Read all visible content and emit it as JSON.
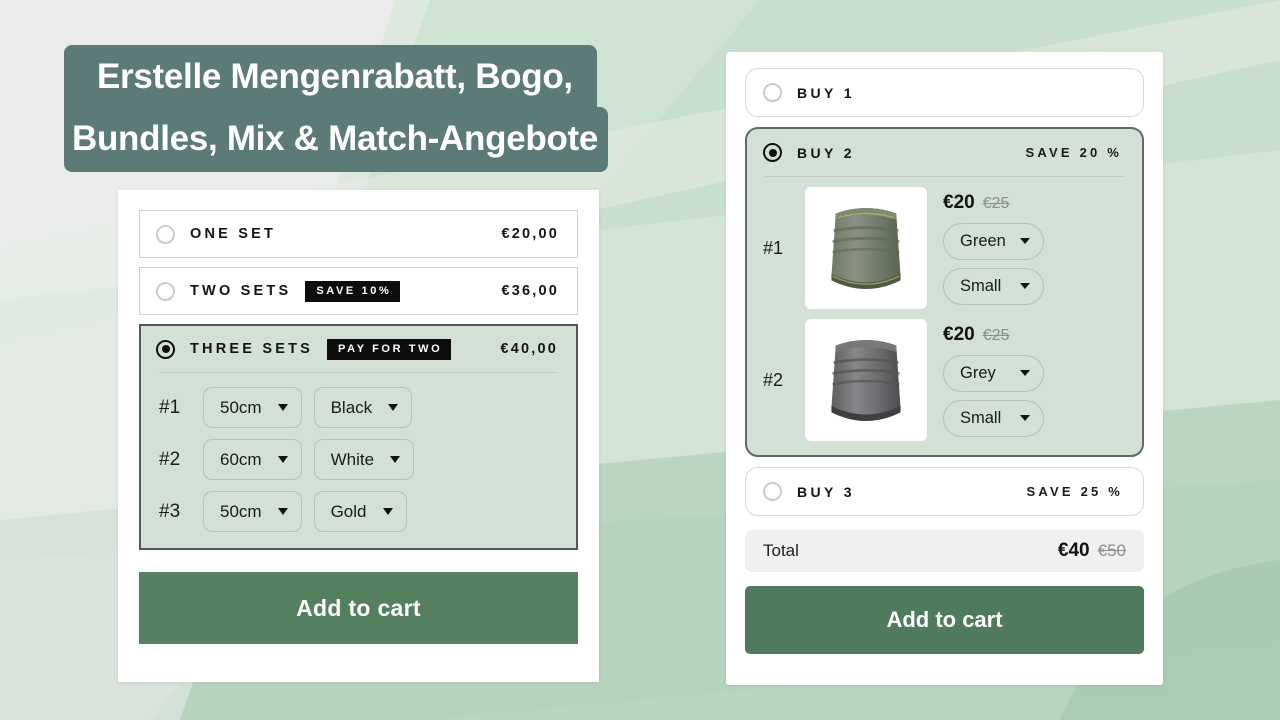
{
  "headline": {
    "line1": "Erstelle Mengenrabatt, Bogo,",
    "line2": "Bundles, Mix & Match-Angebote"
  },
  "colors": {
    "accent_green": "#55805f",
    "selected_fill": "#d3e0d6",
    "badge_bg": "#0d0d0d",
    "headline_bg": "#5c7b78"
  },
  "left_widget": {
    "options": [
      {
        "label": "ONE SET",
        "badge": "",
        "price": "€20,00",
        "selected": false
      },
      {
        "label": "TWO SETS",
        "badge": "SAVE 10%",
        "price": "€36,00",
        "selected": false
      },
      {
        "label": "THREE SETS",
        "badge": "PAY FOR TWO",
        "price": "€40,00",
        "selected": true
      }
    ],
    "variants": [
      {
        "num": "#1",
        "size": "50cm",
        "color": "Black"
      },
      {
        "num": "#2",
        "size": "60cm",
        "color": "White"
      },
      {
        "num": "#3",
        "size": "50cm",
        "color": "Gold"
      }
    ],
    "cta": "Add to cart"
  },
  "right_widget": {
    "options": [
      {
        "label": "BUY 1",
        "save": "",
        "selected": false
      },
      {
        "label": "BUY 2",
        "save": "SAVE 20 %",
        "selected": true
      },
      {
        "label": "BUY 3",
        "save": "SAVE 25 %",
        "selected": false
      }
    ],
    "items": [
      {
        "num": "#1",
        "price_now": "€20",
        "price_was": "€25",
        "color": "Green",
        "size": "Small",
        "thumb": "neck-gaiter-green"
      },
      {
        "num": "#2",
        "price_now": "€20",
        "price_was": "€25",
        "color": "Grey",
        "size": "Small",
        "thumb": "neck-gaiter-grey"
      }
    ],
    "total": {
      "label": "Total",
      "now": "€40",
      "was": "€50"
    },
    "cta": "Add to cart"
  }
}
